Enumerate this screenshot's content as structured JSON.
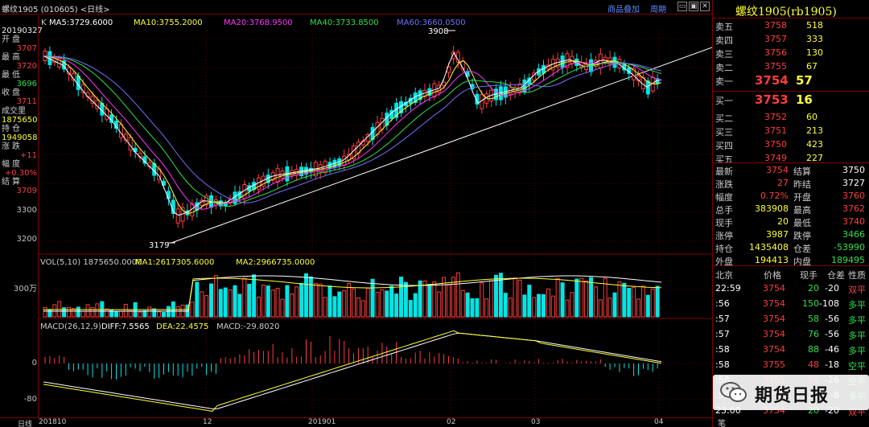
{
  "topbar": {
    "title": "螺纹1905 (010605) <日线>",
    "overlay_btn": "商品叠加",
    "period_btn": "周期"
  },
  "leftpanel": {
    "date": "20190327",
    "open_label": "开盘",
    "open": "3707",
    "high_label": "最高",
    "high": "3720",
    "low_label": "最低",
    "low": "3696",
    "close_label": "收盘",
    "close": "3711",
    "volume_label": "成交里",
    "volume": "1875650",
    "oi_label": "持仓",
    "oi": "1949058",
    "change_label": "涨跌",
    "change": "+11",
    "pct_label": "幅度",
    "pct": "+0.30%",
    "settle_label": "结算",
    "settle": "3709"
  },
  "main_legend": {
    "k": "K",
    "ma5": "MA5:3729.6000",
    "ma10": "MA10:3755.2000",
    "ma20": "MA20:3768.9500",
    "ma40": "MA40:3733.8500",
    "ma60": "MA60:3660.0500"
  },
  "price_axis": {
    "p3300": "3300",
    "p3200": "3200"
  },
  "annotations": {
    "high": "3908",
    "low": "3179"
  },
  "vol_legend": {
    "vol": "VOL(5,10) 1875650.0000",
    "ma1": "MA1:2617305.6000",
    "ma2": "MA2:2966735.0000",
    "axis": "300万"
  },
  "macd_legend": {
    "name": "MACD(26,12,9)",
    "diff": "DIFF:7.5565",
    "dea": "DEA:22.4575",
    "macd": "MACD:-29.8020",
    "axis0": "0",
    "axis80": "-80"
  },
  "bottombar": {
    "period": "日线",
    "d1": "201810",
    "d2": "12",
    "d3": "201901",
    "d4": "02",
    "d5": "03",
    "d6": "04"
  },
  "right": {
    "title": "螺纹1905(rb1905)",
    "asks": [
      {
        "label": "卖五",
        "price": "3758",
        "qty": "518"
      },
      {
        "label": "卖四",
        "price": "3757",
        "qty": "333"
      },
      {
        "label": "卖三",
        "price": "3756",
        "qty": "130"
      },
      {
        "label": "卖二",
        "price": "3755",
        "qty": "67"
      },
      {
        "label": "卖一",
        "price": "3754",
        "qty": "57"
      }
    ],
    "bids": [
      {
        "label": "买一",
        "price": "3753",
        "qty": "16"
      },
      {
        "label": "买二",
        "price": "3752",
        "qty": "60"
      },
      {
        "label": "买三",
        "price": "3751",
        "qty": "213"
      },
      {
        "label": "买四",
        "price": "3750",
        "qty": "423"
      },
      {
        "label": "买五",
        "price": "3749",
        "qty": "227"
      }
    ],
    "stats": [
      {
        "l1": "最新",
        "v1": "3754",
        "l2": "结算",
        "v2": "3750"
      },
      {
        "l1": "涨跌",
        "v1": "27",
        "l2": "昨结",
        "v2": "3727"
      },
      {
        "l1": "幅度",
        "v1": "0.72%",
        "l2": "开盘",
        "v2": "3760"
      },
      {
        "l1": "总手",
        "v1": "383908",
        "l2": "最高",
        "v2": "3762"
      },
      {
        "l1": "现手",
        "v1": "20",
        "l2": "最低",
        "v2": "3740"
      },
      {
        "l1": "涨停",
        "v1": "3987",
        "l2": "跌停",
        "v2": "3466"
      },
      {
        "l1": "持仓",
        "v1": "1435408",
        "l2": "仓差",
        "v2": "-53990"
      },
      {
        "l1": "外盘",
        "v1": "194413",
        "l2": "内盘",
        "v2": "189495"
      }
    ],
    "ticks_header": {
      "c1": "北京",
      "c2": "价格",
      "c3": "现手",
      "c4": "仓差",
      "c5": "性质"
    },
    "ticks": [
      {
        "t": "22:59",
        "p": "3754",
        "q": "20",
        "d": "-20",
        "n": "双平"
      },
      {
        "t": ":56",
        "p": "3754",
        "q": "150",
        "d": "-108",
        "n": "多平"
      },
      {
        "t": ":57",
        "p": "3754",
        "q": "58",
        "d": "-56",
        "n": "多平"
      },
      {
        "t": ":57",
        "p": "3754",
        "q": "76",
        "d": "-56",
        "n": "多平"
      },
      {
        "t": ":58",
        "p": "3754",
        "q": "88",
        "d": "-46",
        "n": "多平"
      },
      {
        "t": ":58",
        "p": "3755",
        "q": "48",
        "d": "-18",
        "n": "空平"
      },
      {
        "t": ":58",
        "p": "3755",
        "q": "50",
        "d": "-26",
        "n": "空平"
      },
      {
        "t": ":59",
        "p": "3754",
        "q": "20",
        "d": "-8",
        "n": "多平"
      },
      {
        "t": "23:00",
        "p": "3754",
        "q": "20",
        "d": "-20",
        "n": "双平"
      }
    ],
    "footer_tab": "笔"
  },
  "watermark": {
    "text": "期货日报"
  },
  "colors": {
    "up": "#ff3c3c",
    "down": "#00e5e5",
    "ma5": "#ffffff",
    "ma10": "#ffff33",
    "ma20": "#ff33ff",
    "ma40": "#2fe04a",
    "ma60": "#7070ff",
    "frame": "#7a0000"
  }
}
